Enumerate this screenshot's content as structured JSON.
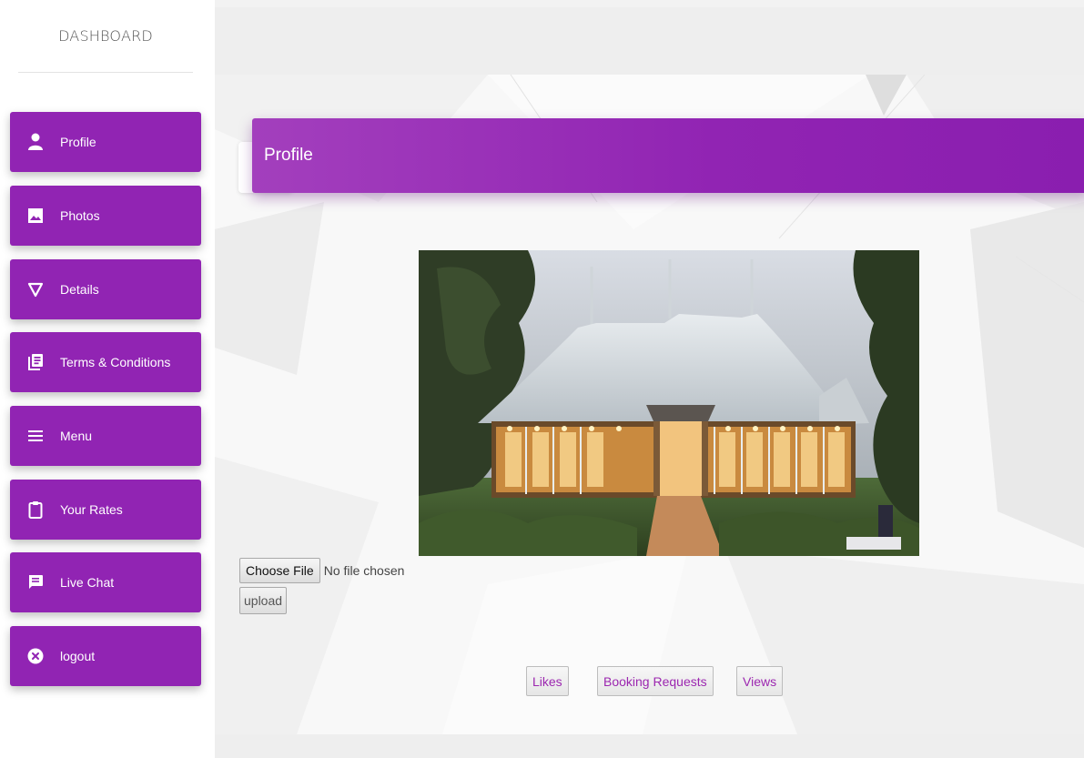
{
  "sidebar": {
    "brand": "DASHBOARD",
    "items": [
      {
        "label": "Profile",
        "icon": "person-icon"
      },
      {
        "label": "Photos",
        "icon": "image-icon"
      },
      {
        "label": "Details",
        "icon": "nabla-icon"
      },
      {
        "label": "Terms & Conditions",
        "icon": "document-list-icon"
      },
      {
        "label": "Menu",
        "icon": "hamburger-menu-icon"
      },
      {
        "label": "Your Rates",
        "icon": "clipboard-icon"
      },
      {
        "label": "Live Chat",
        "icon": "chat-icon"
      },
      {
        "label": "logout",
        "icon": "close-circle-icon"
      }
    ]
  },
  "main": {
    "header_title": "Profile",
    "upload": {
      "choose_file_label": "Choose File",
      "file_status": "No file chosen",
      "upload_label": "upload"
    },
    "stats": {
      "likes_label": "Likes",
      "booking_requests_label": "Booking Requests",
      "views_label": "Views"
    }
  },
  "colors": {
    "accent": "#9124b3",
    "accent_light": "#a33fbd",
    "link_text": "#9c27b0"
  }
}
